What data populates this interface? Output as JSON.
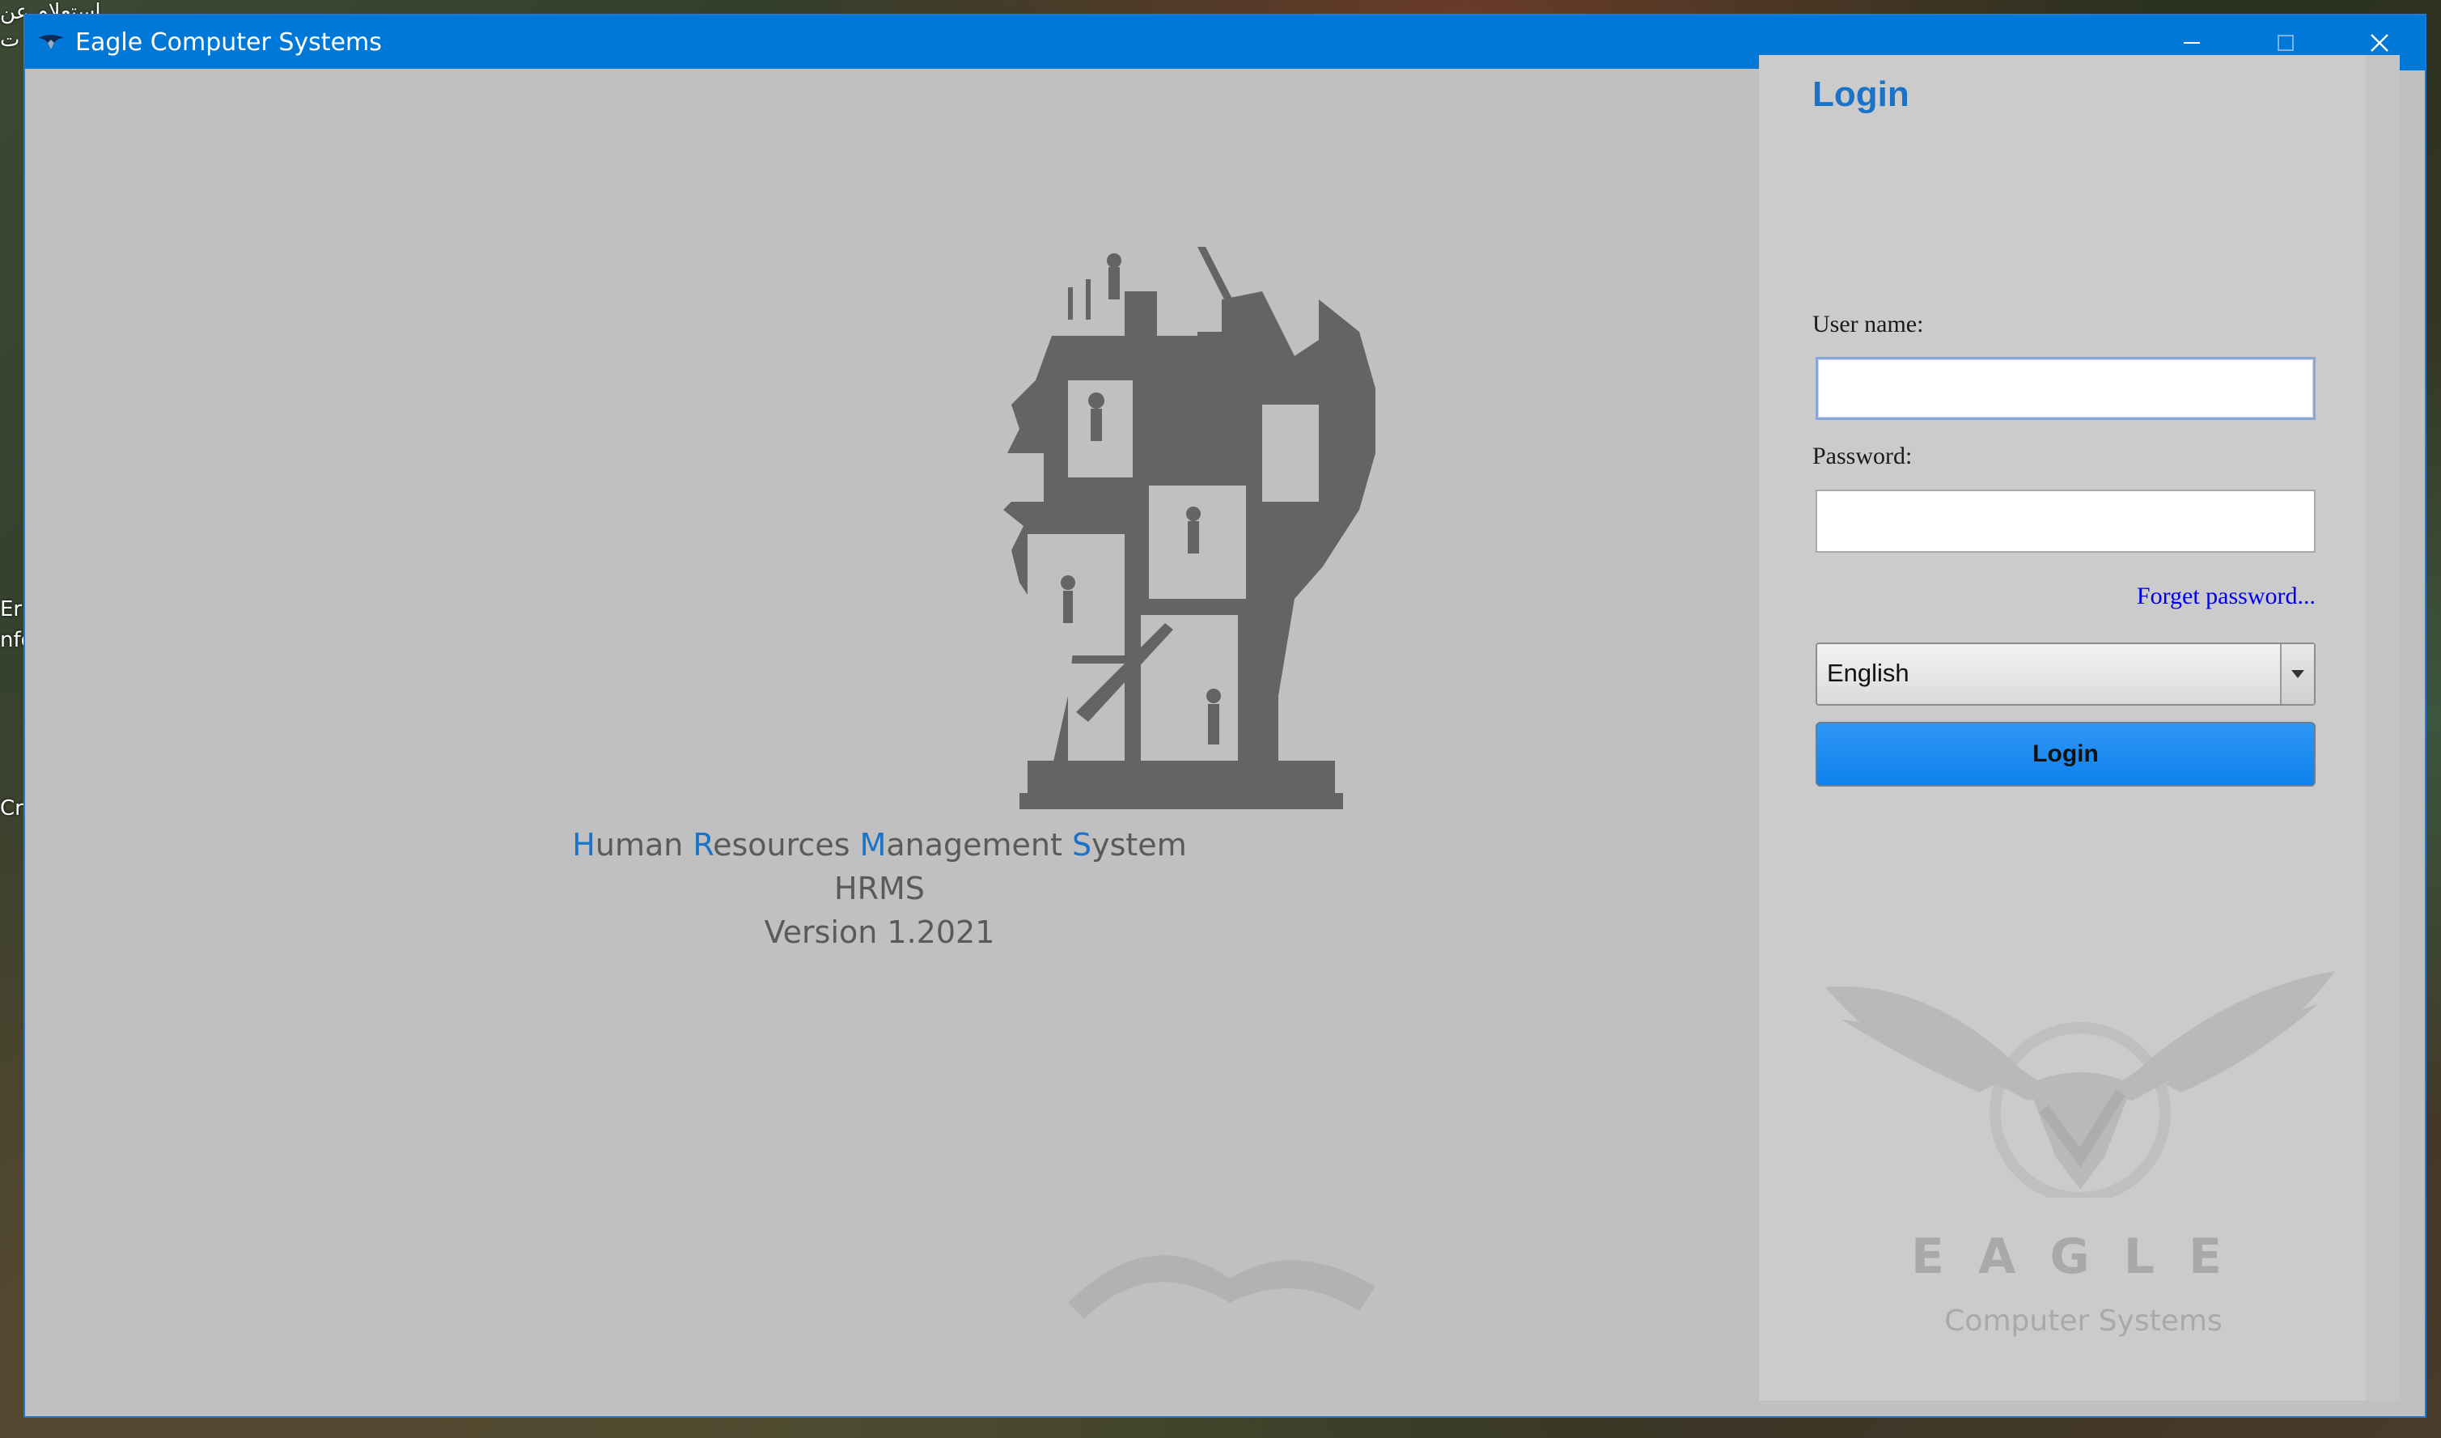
{
  "desktop": {
    "fragments": [
      "إستعلام عن",
      "ي ت",
      "Er",
      "nfo",
      "Cr"
    ]
  },
  "window": {
    "title": "Eagle Computer Systems",
    "controls": {
      "minimize": "minimize-icon",
      "maximize": "maximize-icon",
      "close": "close-icon"
    }
  },
  "splash": {
    "product_name_parts": [
      {
        "text": "H",
        "highlight": true
      },
      {
        "text": "uman ",
        "highlight": false
      },
      {
        "text": "R",
        "highlight": true
      },
      {
        "text": "esources ",
        "highlight": false
      },
      {
        "text": "M",
        "highlight": true
      },
      {
        "text": "anagement ",
        "highlight": false
      },
      {
        "text": "S",
        "highlight": true
      },
      {
        "text": "ystem",
        "highlight": false
      }
    ],
    "abbreviation": "HRMS",
    "version": "Version 1.2021"
  },
  "login": {
    "heading": "Login",
    "username_label": "User name:",
    "username_value": "",
    "password_label": "Password:",
    "password_value": "",
    "forget_password": "Forget password...",
    "language": "English",
    "button_label": "Login"
  },
  "brand": {
    "word": "EAGLE",
    "subtitle": "Computer Systems"
  },
  "colors": {
    "titlebar": "#0078d7",
    "accent": "#1a73c9",
    "button": "#1589f0",
    "link": "#0000ee"
  }
}
